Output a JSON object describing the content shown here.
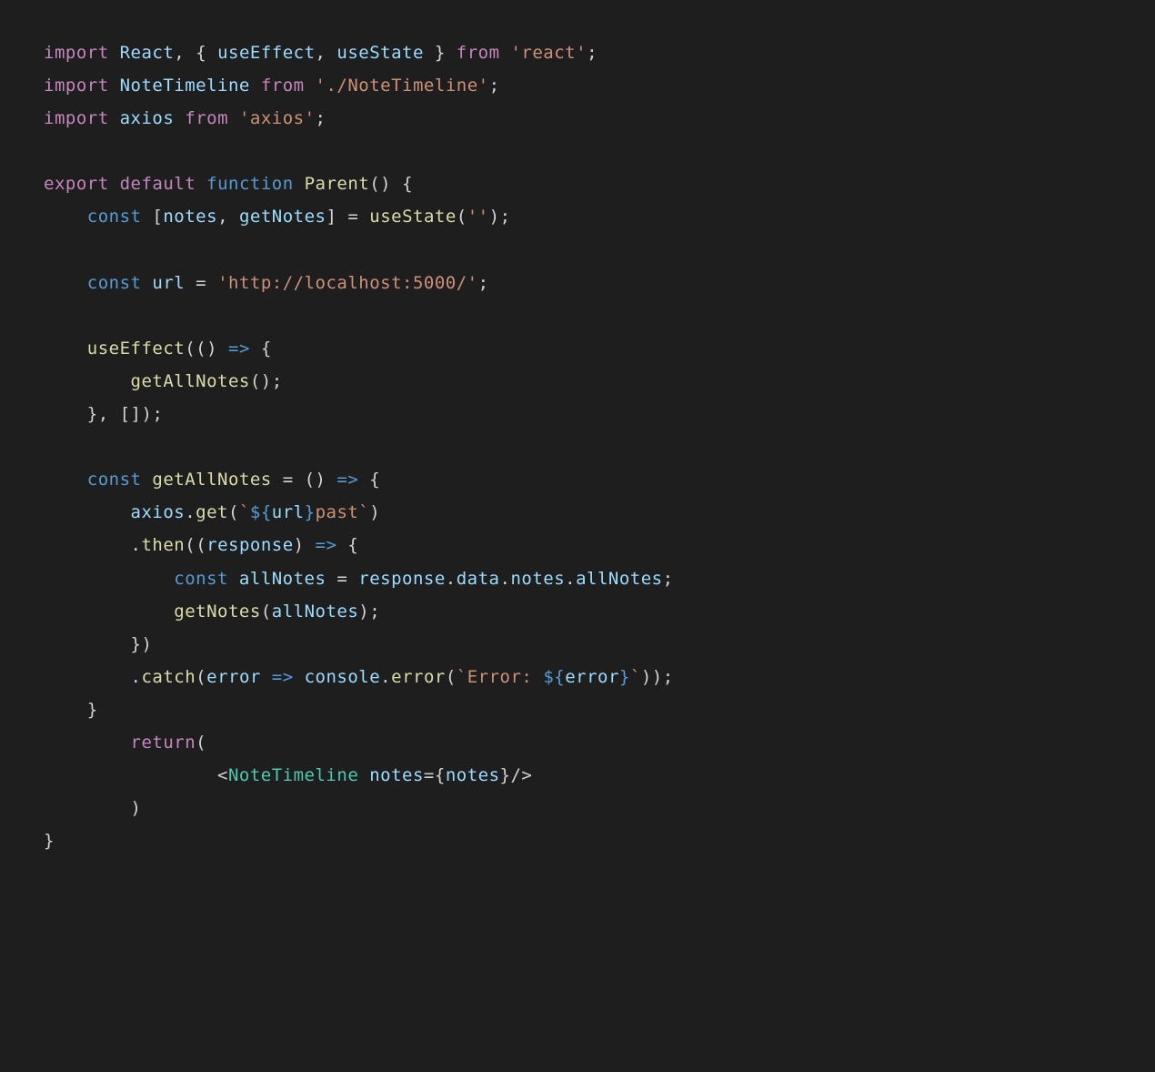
{
  "code": {
    "line1": {
      "import": "import",
      "react": "React",
      "comma": ",",
      "lbrace": " { ",
      "useEffect": "useEffect",
      "comma2": ", ",
      "useState": "useState",
      "rbrace": " } ",
      "from": "from",
      "reactStr": "'react'",
      "semi": ";"
    },
    "line2": {
      "import": "import",
      "noteTimeline": "NoteTimeline",
      "from": "from",
      "path": "'./NoteTimeline'",
      "semi": ";"
    },
    "line3": {
      "import": "import",
      "axios": "axios",
      "from": "from",
      "axiosStr": "'axios'",
      "semi": ";"
    },
    "line5": {
      "export": "export",
      "default": "default",
      "function": "function",
      "parent": "Parent",
      "parens": "()",
      "lbrace": " {"
    },
    "line6": {
      "indent": "    ",
      "const": "const",
      "lbracket": " [",
      "notes": "notes",
      "comma": ", ",
      "getNotes": "getNotes",
      "rbracket": "] ",
      "equals": "= ",
      "useState": "useState",
      "lparen": "(",
      "emptyStr": "''",
      "rparen": ")",
      "semi": ";"
    },
    "line8": {
      "indent": "    ",
      "const": "const",
      "url": " url ",
      "equals": "= ",
      "urlStr": "'http://localhost:5000/'",
      "semi": ";"
    },
    "line10": {
      "indent": "    ",
      "useEffect": "useEffect",
      "lparen": "(",
      "lparen2": "()",
      "arrow": " => ",
      "lbrace": "{"
    },
    "line11": {
      "indent": "        ",
      "getAllNotes": "getAllNotes",
      "parens": "()",
      "semi": ";"
    },
    "line12": {
      "indent": "    ",
      "rbrace": "}",
      "comma": ", ",
      "brackets": "[]",
      "rparen": ")",
      "semi": ";"
    },
    "line14": {
      "indent": "    ",
      "const": "const",
      "getAllNotes": " getAllNotes ",
      "equals": "= ",
      "parens": "()",
      "arrow": " => ",
      "lbrace": "{"
    },
    "line15": {
      "indent": "        ",
      "axios": "axios",
      "dot": ".",
      "get": "get",
      "lparen": "(",
      "backtick1": "`",
      "dollar": "${",
      "url": "url",
      "closeBrace": "}",
      "past": "past",
      "backtick2": "`",
      "rparen": ")"
    },
    "line16": {
      "indent": "        ",
      "dot": ".",
      "then": "then",
      "lparen": "(",
      "lparen2": "(",
      "response": "response",
      "rparen2": ")",
      "arrow": " => ",
      "lbrace": "{"
    },
    "line17": {
      "indent": "            ",
      "const": "const",
      "allNotes": " allNotes ",
      "equals": "= ",
      "response": "response",
      "dot1": ".",
      "data": "data",
      "dot2": ".",
      "notes": "notes",
      "dot3": ".",
      "allNotes2": "allNotes",
      "semi": ";"
    },
    "line18": {
      "indent": "            ",
      "getNotes": "getNotes",
      "lparen": "(",
      "allNotes": "allNotes",
      "rparen": ")",
      "semi": ";"
    },
    "line19": {
      "indent": "        ",
      "rbrace": "}",
      "rparen": ")"
    },
    "line20": {
      "indent": "        ",
      "dot": ".",
      "catch": "catch",
      "lparen": "(",
      "error": "error",
      "arrow": " => ",
      "console": "console",
      "dot2": ".",
      "errorFn": "error",
      "lparen2": "(",
      "backtick1": "`",
      "errorStr": "Error: ",
      "dollar": "${",
      "errorVar": "error",
      "closeBrace": "}",
      "backtick2": "`",
      "rparen2": ")",
      "rparen": ")",
      "semi": ";"
    },
    "line21": {
      "indent": "    ",
      "rbrace": "}"
    },
    "line22": {
      "indent": "        ",
      "return": "return",
      "lparen": "("
    },
    "line23": {
      "indent": "                ",
      "lt": "<",
      "noteTimeline": "NoteTimeline",
      "space": " ",
      "notesAttr": "notes",
      "equals": "=",
      "lbrace": "{",
      "notes": "notes",
      "rbrace": "}",
      "slash": "/>"
    },
    "line24": {
      "indent": "        ",
      "rparen": ")"
    },
    "line25": {
      "rbrace": "}"
    }
  }
}
